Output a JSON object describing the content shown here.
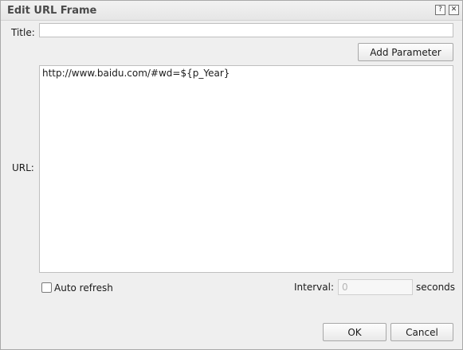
{
  "dialog": {
    "title": "Edit URL Frame",
    "help_icon": "?",
    "close_icon": "✕"
  },
  "form": {
    "title_label": "Title:",
    "title_value": "",
    "add_parameter_label": "Add Parameter",
    "url_label": "URL:",
    "url_value": "http://www.baidu.com/#wd=${p_Year}",
    "auto_refresh_label": "Auto refresh",
    "auto_refresh_checked": false,
    "interval_label": "Interval:",
    "interval_value": "0",
    "interval_unit": "seconds"
  },
  "footer": {
    "ok_label": "OK",
    "cancel_label": "Cancel"
  }
}
